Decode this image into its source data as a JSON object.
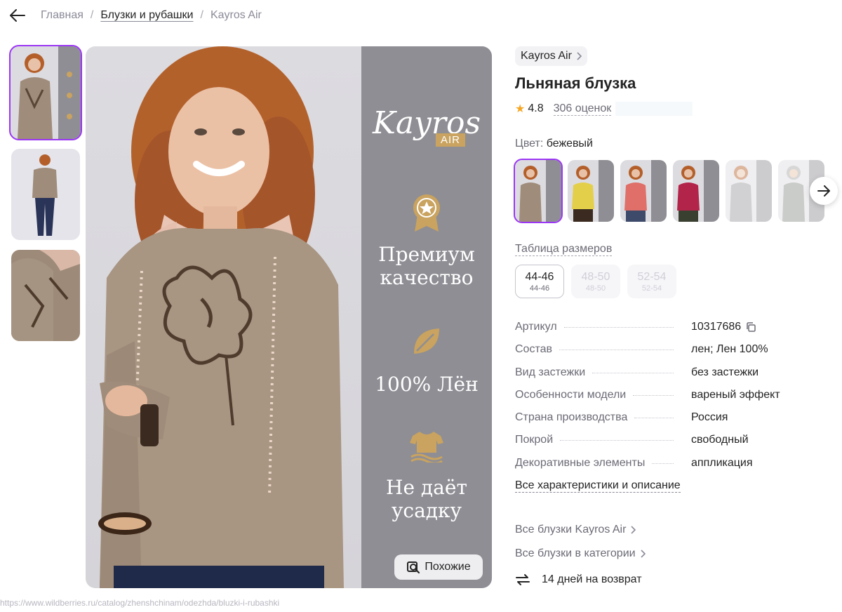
{
  "breadcrumb": {
    "items": [
      "Главная",
      "Блузки и рубашки",
      "Kayros Air"
    ],
    "separator": "/"
  },
  "gallery": {
    "thumbnails": [
      "thumb-1",
      "thumb-2",
      "thumb-3"
    ],
    "panel": {
      "brand_script": "Kayros",
      "brand_air": "AIR",
      "feature1": "Премиум качество",
      "feature2": "100% Лён",
      "feature3": "Не даёт усадку"
    },
    "similar_label": "Похожие"
  },
  "status_url": "https://www.wildberries.ru/catalog/zhenshchinam/odezhda/bluzki-i-rubashki",
  "product": {
    "brand": "Kayros Air",
    "title": "Льняная блузка",
    "rating": "4.8",
    "reviews": "306 оценок",
    "color_label": "Цвет:",
    "color_value": "бежевый",
    "swatches": [
      "beige",
      "yellow",
      "coral",
      "crimson",
      "grey-light",
      "grey"
    ],
    "size_table_label": "Таблица размеров",
    "sizes": [
      {
        "main": "44-46",
        "sub": "44-46"
      },
      {
        "main": "48-50",
        "sub": "48-50"
      },
      {
        "main": "52-54",
        "sub": "52-54"
      }
    ],
    "specs": [
      {
        "key": "Артикул",
        "value": "10317686"
      },
      {
        "key": "Состав",
        "value": "лен; Лен 100%"
      },
      {
        "key": "Вид застежки",
        "value": "без застежки"
      },
      {
        "key": "Особенности модели",
        "value": "вареный эффект"
      },
      {
        "key": "Страна производства",
        "value": "Россия"
      },
      {
        "key": "Покрой",
        "value": "свободный"
      },
      {
        "key": "Декоративные элементы",
        "value": "аппликация"
      }
    ],
    "all_characteristics": "Все характеристики и описание",
    "links": [
      "Все блузки Kayros Air",
      "Все блузки в категории"
    ],
    "return_text": "14 дней на возврат"
  },
  "colors": {
    "accent": "#9b36f5",
    "star": "#f5a623",
    "panel": "#8f8e94",
    "gold": "#c9a35f"
  }
}
